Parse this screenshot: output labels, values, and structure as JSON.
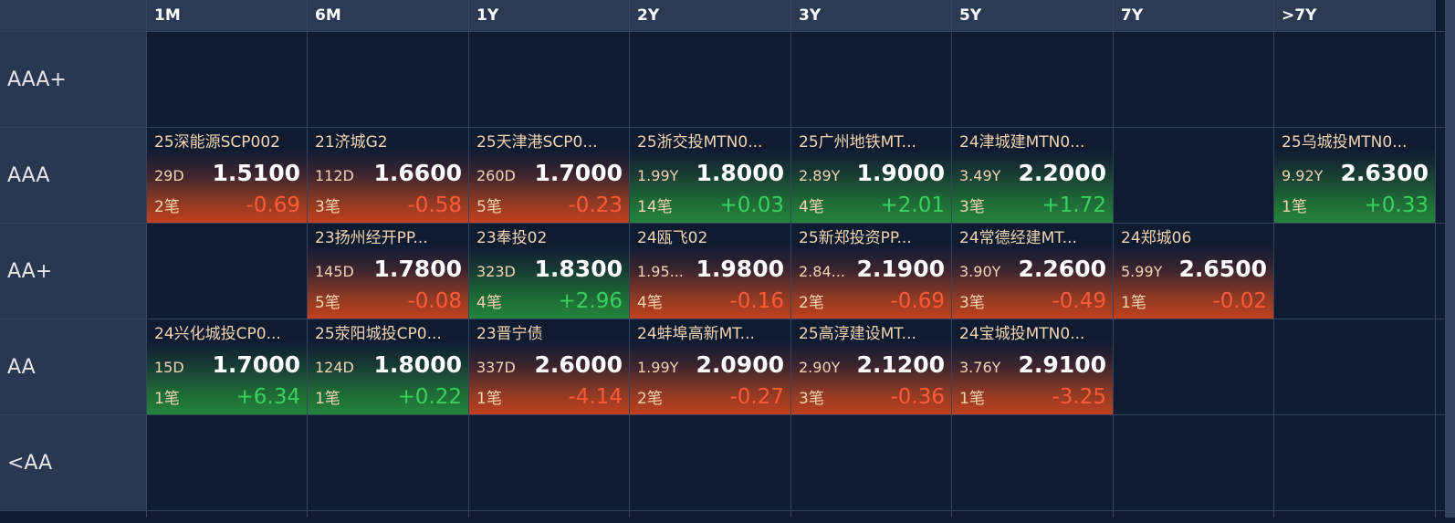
{
  "columns": [
    "1M",
    "6M",
    "1Y",
    "2Y",
    "3Y",
    "5Y",
    "7Y",
    ">7Y"
  ],
  "rows": [
    {
      "label": "AAA+",
      "cells": [
        null,
        null,
        null,
        null,
        null,
        null,
        null,
        null
      ]
    },
    {
      "label": "AAA",
      "cells": [
        {
          "name": "25深能源SCP002",
          "term": "29D",
          "yield": "1.5100",
          "count": "2笔",
          "change": "-0.69",
          "trend": "down"
        },
        {
          "name": "21济城G2",
          "term": "112D",
          "yield": "1.6600",
          "count": "3笔",
          "change": "-0.58",
          "trend": "down"
        },
        {
          "name": "25天津港SCP0...",
          "term": "260D",
          "yield": "1.7000",
          "count": "5笔",
          "change": "-0.23",
          "trend": "down"
        },
        {
          "name": "25浙交投MTN0...",
          "term": "1.99Y",
          "yield": "1.8000",
          "count": "14笔",
          "change": "+0.03",
          "trend": "up"
        },
        {
          "name": "25广州地铁MT...",
          "term": "2.89Y",
          "yield": "1.9000",
          "count": "4笔",
          "change": "+2.01",
          "trend": "up"
        },
        {
          "name": "24津城建MTN0...",
          "term": "3.49Y",
          "yield": "2.2000",
          "count": "3笔",
          "change": "+1.72",
          "trend": "up"
        },
        null,
        {
          "name": "25乌城投MTN0...",
          "term": "9.92Y",
          "yield": "2.6300",
          "count": "1笔",
          "change": "+0.33",
          "trend": "up"
        }
      ]
    },
    {
      "label": "AA+",
      "cells": [
        null,
        {
          "name": "23扬州经开PP...",
          "term": "145D",
          "yield": "1.7800",
          "count": "5笔",
          "change": "-0.08",
          "trend": "down"
        },
        {
          "name": "23奉投02",
          "term": "323D",
          "yield": "1.8300",
          "count": "4笔",
          "change": "+2.96",
          "trend": "up"
        },
        {
          "name": "24瓯飞02",
          "term": "1.95...",
          "yield": "1.9800",
          "count": "4笔",
          "change": "-0.16",
          "trend": "down"
        },
        {
          "name": "25新郑投资PP...",
          "term": "2.84...",
          "yield": "2.1900",
          "count": "2笔",
          "change": "-0.69",
          "trend": "down"
        },
        {
          "name": "24常德经建MT...",
          "term": "3.90Y",
          "yield": "2.2600",
          "count": "3笔",
          "change": "-0.49",
          "trend": "down"
        },
        {
          "name": "24郑城06",
          "term": "5.99Y",
          "yield": "2.6500",
          "count": "1笔",
          "change": "-0.02",
          "trend": "down"
        },
        null
      ]
    },
    {
      "label": "AA",
      "cells": [
        {
          "name": "24兴化城投CP0...",
          "term": "15D",
          "yield": "1.7000",
          "count": "1笔",
          "change": "+6.34",
          "trend": "up"
        },
        {
          "name": "25荥阳城投CP0...",
          "term": "124D",
          "yield": "1.8000",
          "count": "1笔",
          "change": "+0.22",
          "trend": "up"
        },
        {
          "name": "23晋宁债",
          "term": "337D",
          "yield": "2.6000",
          "count": "1笔",
          "change": "-4.14",
          "trend": "down"
        },
        {
          "name": "24蚌埠高新MT...",
          "term": "1.99Y",
          "yield": "2.0900",
          "count": "2笔",
          "change": "-0.27",
          "trend": "down"
        },
        {
          "name": "25高淳建设MT...",
          "term": "2.90Y",
          "yield": "2.1200",
          "count": "3笔",
          "change": "-0.36",
          "trend": "down"
        },
        {
          "name": "24宝城投MTN0...",
          "term": "3.76Y",
          "yield": "2.9100",
          "count": "1笔",
          "change": "-3.25",
          "trend": "down"
        },
        null,
        null
      ]
    },
    {
      "label": "<AA",
      "cells": [
        null,
        null,
        null,
        null,
        null,
        null,
        null,
        null
      ]
    }
  ]
}
